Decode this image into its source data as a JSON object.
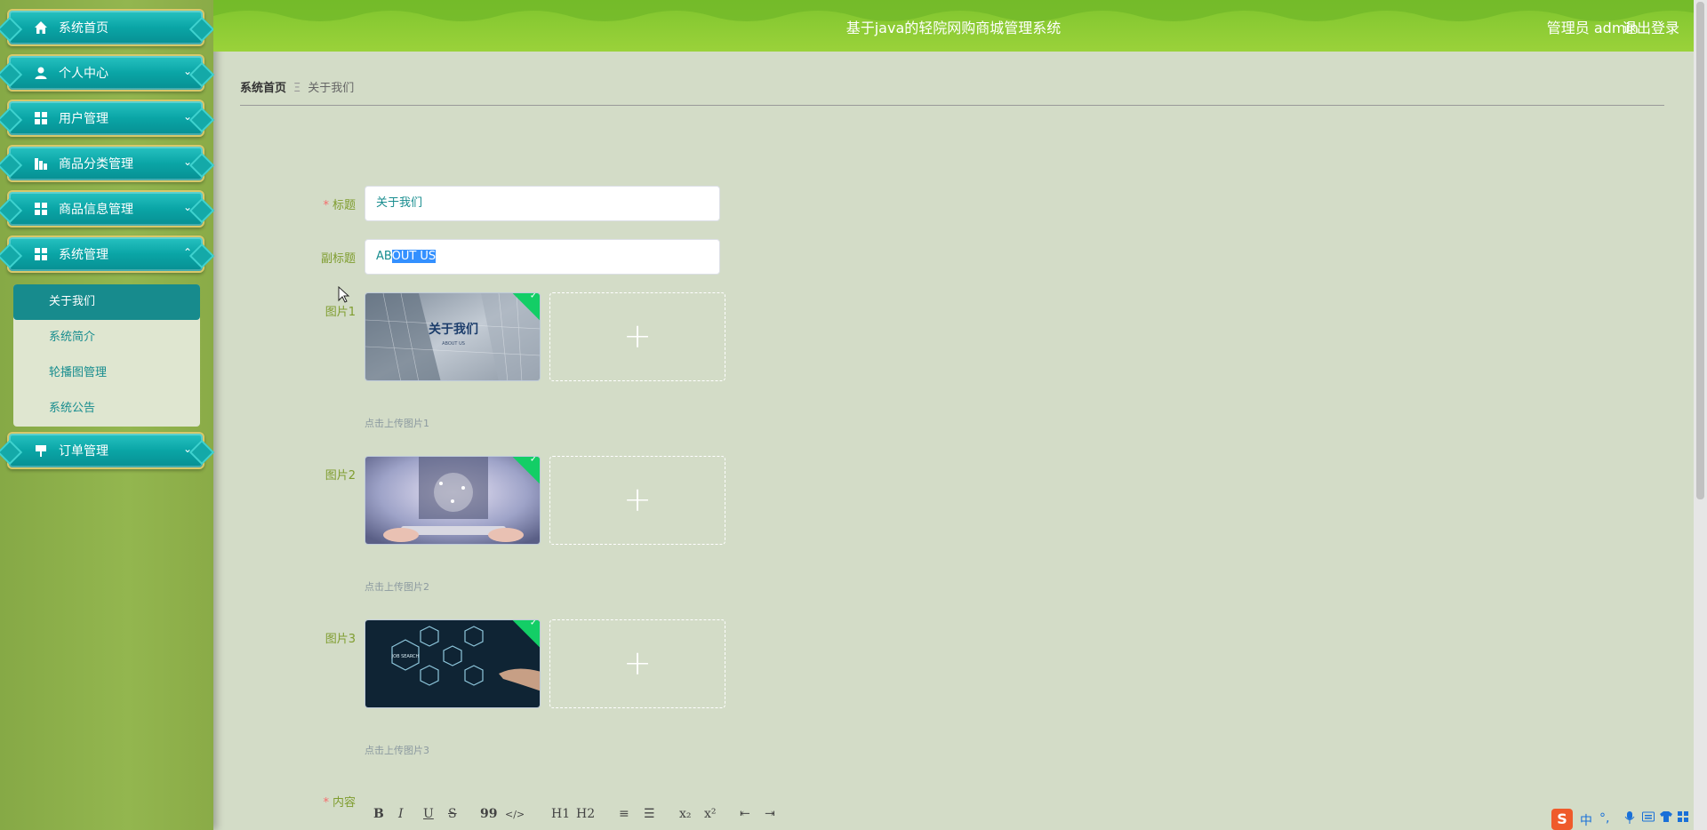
{
  "header": {
    "title": "基于java的轻院网购商城管理系统",
    "user": "管理员 admin",
    "logout": "退出登录"
  },
  "sidebar": {
    "items": [
      {
        "label": "系统首页",
        "icon": "home-icon"
      },
      {
        "label": "个人中心",
        "icon": "user-icon"
      },
      {
        "label": "用户管理",
        "icon": "grid-icon"
      },
      {
        "label": "商品分类管理",
        "icon": "chart-icon"
      },
      {
        "label": "商品信息管理",
        "icon": "grid-icon"
      },
      {
        "label": "系统管理",
        "icon": "grid-icon"
      },
      {
        "label": "订单管理",
        "icon": "flag-icon"
      }
    ],
    "submenu": [
      "关于我们",
      "系统简介",
      "轮播图管理",
      "系统公告"
    ]
  },
  "breadcrumb": {
    "home": "系统首页",
    "separator": "Ξ",
    "current": "关于我们"
  },
  "form": {
    "title_label": "标题",
    "title_value": "关于我们",
    "subtitle_label": "副标题",
    "subtitle_prefix": "AB",
    "subtitle_selected": "OUT US",
    "images": [
      {
        "label": "图片1",
        "tip": "点击上传图片1",
        "thumb_text": "关于我们",
        "thumb_sub": "ABOUT US"
      },
      {
        "label": "图片2",
        "tip": "点击上传图片2"
      },
      {
        "label": "图片3",
        "tip": "点击上传图片3",
        "thumb_text": "JOB SEARCH"
      }
    ],
    "content_label": "内容",
    "plus": "+"
  },
  "toolbar": [
    "B",
    "I",
    "U",
    "S",
    "99",
    "</>",
    "H1",
    "H2",
    "≡",
    "☰",
    "x₂",
    "x²",
    "⇤",
    "⇥"
  ],
  "ime": {
    "s": "S",
    "zh": "中",
    "punct": "°,"
  },
  "colors": {
    "accent": "#188d8f",
    "header": "#8ccb35",
    "label": "#7f9d2f"
  }
}
